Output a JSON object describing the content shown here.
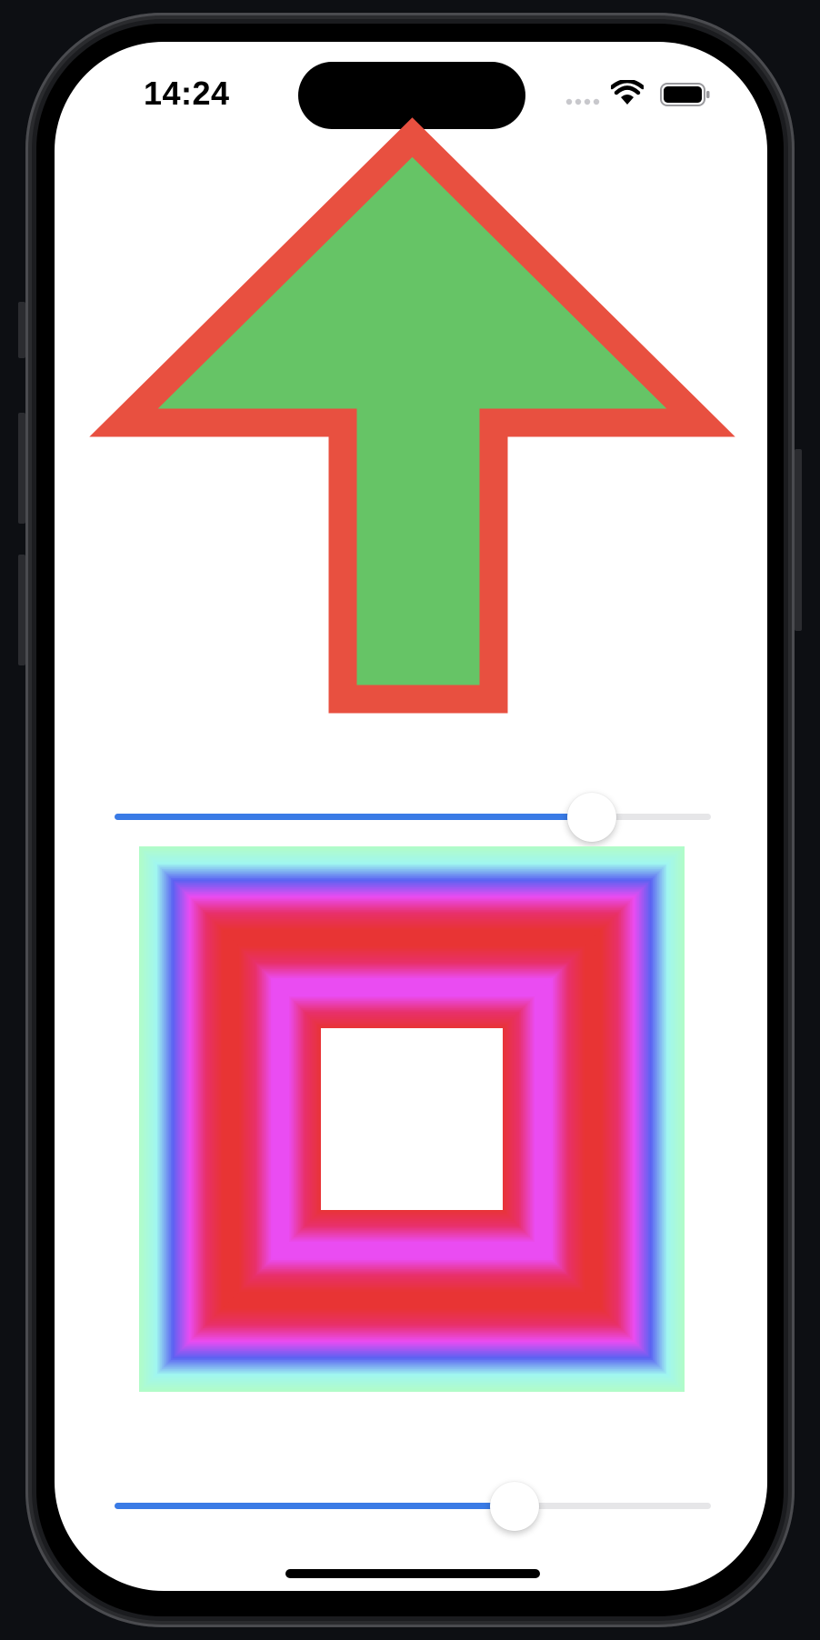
{
  "status_bar": {
    "time": "14:24"
  },
  "arrow": {
    "direction": "up",
    "fill_color": "#66c466",
    "stroke_color": "#e85040"
  },
  "slider_top": {
    "value": 0.8
  },
  "slider_bottom": {
    "value": 0.67
  },
  "gradient_square": {
    "colors": [
      "#b1fcc8",
      "#a0f6f0",
      "#5a62f2",
      "#ea4cf2",
      "#e8306a",
      "#e83434"
    ],
    "center_color": "#ffffff"
  },
  "accent_color": "#3a7be6"
}
